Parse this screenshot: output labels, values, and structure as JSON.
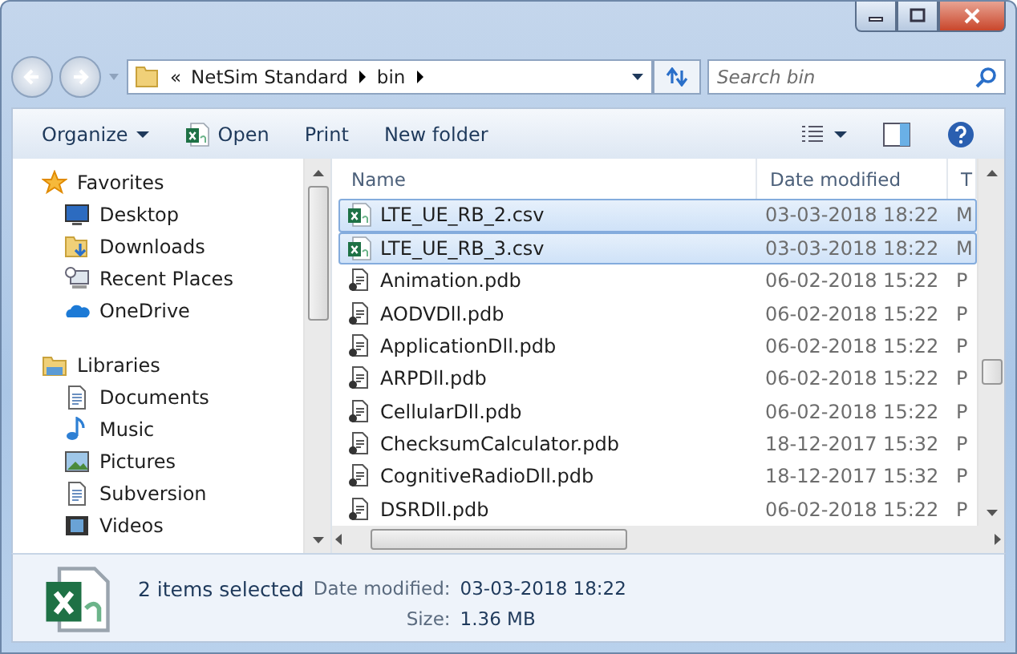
{
  "address": {
    "overflow": "«",
    "crumbs": [
      "NetSim Standard",
      "bin"
    ]
  },
  "search": {
    "placeholder": "Search bin"
  },
  "toolbar": {
    "items": [
      {
        "label": "Organize",
        "kind": "menu"
      },
      {
        "label": "Open",
        "kind": "excel"
      },
      {
        "label": "Print",
        "kind": "plain"
      },
      {
        "label": "New folder",
        "kind": "plain"
      }
    ]
  },
  "sidebar": {
    "groups": [
      {
        "label": "Favorites",
        "kind": "star",
        "children": [
          {
            "label": "Desktop",
            "kind": "desktop"
          },
          {
            "label": "Downloads",
            "kind": "downloads"
          },
          {
            "label": "Recent Places",
            "kind": "recent"
          },
          {
            "label": "OneDrive",
            "kind": "cloud"
          }
        ]
      },
      {
        "label": "Libraries",
        "kind": "library",
        "children": [
          {
            "label": "Documents",
            "kind": "document"
          },
          {
            "label": "Music",
            "kind": "music"
          },
          {
            "label": "Pictures",
            "kind": "picture"
          },
          {
            "label": "Subversion",
            "kind": "document"
          },
          {
            "label": "Videos",
            "kind": "video"
          }
        ]
      }
    ]
  },
  "table": {
    "columns": [
      "Name",
      "Date modified",
      "T"
    ],
    "rows": [
      {
        "name": "LTE_UE_RB_2.csv",
        "date": "03-03-2018 18:22",
        "column_3": "M",
        "kind": "csv",
        "selected": true
      },
      {
        "name": "LTE_UE_RB_3.csv",
        "date": "03-03-2018 18:22",
        "column_3": "M",
        "kind": "csv",
        "selected": true
      },
      {
        "name": "Animation.pdb",
        "date": "06-02-2018 15:22",
        "column_3": "P",
        "kind": "pdb",
        "selected": false
      },
      {
        "name": "AODVDll.pdb",
        "date": "06-02-2018 15:22",
        "column_3": "P",
        "kind": "pdb",
        "selected": false
      },
      {
        "name": "ApplicationDll.pdb",
        "date": "06-02-2018 15:22",
        "column_3": "P",
        "kind": "pdb",
        "selected": false
      },
      {
        "name": "ARPDll.pdb",
        "date": "06-02-2018 15:22",
        "column_3": "P",
        "kind": "pdb",
        "selected": false
      },
      {
        "name": "CellularDll.pdb",
        "date": "06-02-2018 15:22",
        "column_3": "P",
        "kind": "pdb",
        "selected": false
      },
      {
        "name": "ChecksumCalculator.pdb",
        "date": "18-12-2017 15:32",
        "column_3": "P",
        "kind": "pdb",
        "selected": false
      },
      {
        "name": "CognitiveRadioDll.pdb",
        "date": "18-12-2017 15:32",
        "column_3": "P",
        "kind": "pdb",
        "selected": false
      },
      {
        "name": "DSRDll.pdb",
        "date": "06-02-2018 15:22",
        "column_3": "P",
        "kind": "pdb",
        "selected": false
      }
    ]
  },
  "details": {
    "summary": "2 items selected",
    "fields": [
      {
        "label": "Date modified:",
        "value": "03-03-2018 18:22"
      },
      {
        "label": "Size:",
        "value": "1.36 MB"
      }
    ]
  }
}
